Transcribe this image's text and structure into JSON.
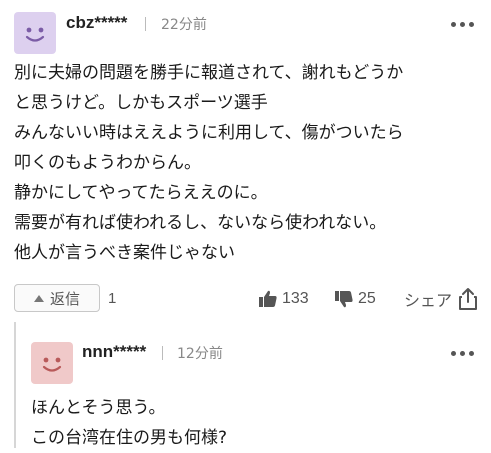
{
  "comment": {
    "username": "cbz*****",
    "time": "22分前",
    "avatar_color": "#ddd0ef",
    "lines": [
      "別に夫婦の問題を勝手に報道されて、謝れもどうか",
      "と思うけど。しかもスポーツ選手",
      "みんないい時はええように利用して、傷がついたら",
      "叩くのもようわからん。",
      "静かにしてやってたらええのに。",
      "需要が有れば使われるし、ないなら使われない。",
      "他人が言うべき案件じゃない"
    ],
    "reply_label": "返信",
    "reply_count": "1",
    "likes": "133",
    "dislikes": "25",
    "share_label": "シェア"
  },
  "reply": {
    "username": "nnn*****",
    "time": "12分前",
    "avatar_color": "#f0c9c9",
    "lines": [
      "ほんとそう思う。",
      "この台湾在住の男も何様?"
    ]
  }
}
